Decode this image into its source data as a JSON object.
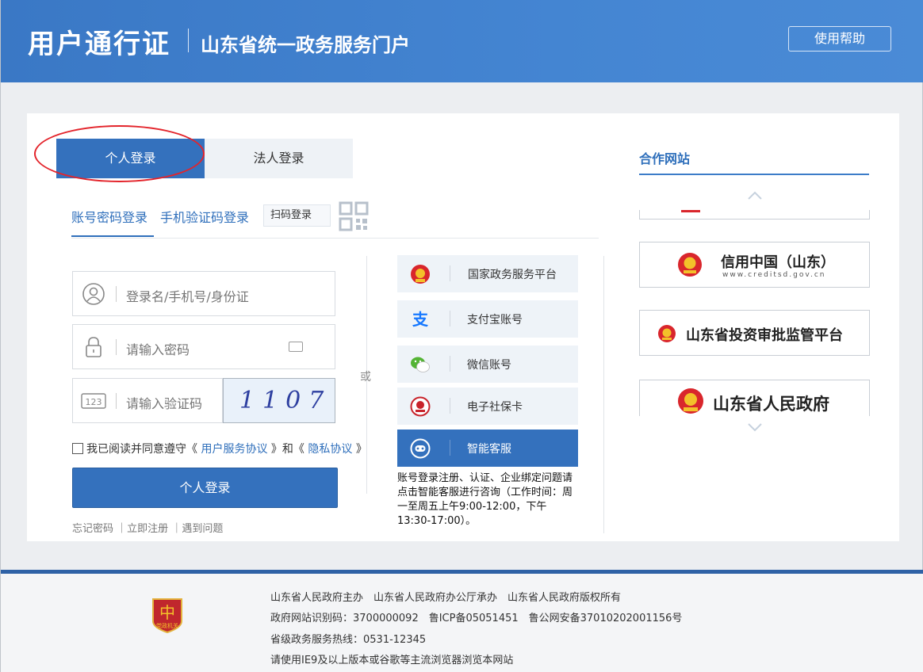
{
  "header": {
    "brand": "用户通行证",
    "portal": "山东省统一政务服务门户",
    "help_label": "使用帮助"
  },
  "login": {
    "tabs": [
      {
        "label": "个人登录",
        "active": true
      },
      {
        "label": "法人登录",
        "active": false
      }
    ],
    "modes": [
      "账号密码登录",
      "手机验证码登录",
      "扫码登录"
    ],
    "username_placeholder": "登录名/手机号/身份证",
    "password_placeholder": "请输入密码",
    "captcha_placeholder": "请输入验证码",
    "captcha_text": "1107",
    "captcha_icon_text": "123",
    "agree_prefix": "我已阅读并同意遵守《",
    "agree_link1": "用户服务协议",
    "agree_mid": "》和《",
    "agree_link2": "隐私协议",
    "agree_suffix": "》",
    "submit_label": "个人登录",
    "links": [
      "忘记密码",
      "立即注册",
      "遇到问题"
    ],
    "or_label": "或"
  },
  "third_party": {
    "items": [
      {
        "label": "国家政务服务平台",
        "icon": "national-emblem-icon"
      },
      {
        "label": "支付宝账号",
        "icon": "alipay-icon"
      },
      {
        "label": "微信账号",
        "icon": "wechat-icon"
      },
      {
        "label": "电子社保卡",
        "icon": "social-security-icon"
      },
      {
        "label": "智能客服",
        "icon": "smart-service-icon"
      }
    ],
    "note": "账号登录注册、认证、企业绑定问题请点击智能客服进行咨询（工作时间：周一至周五上午9:00-12:00，下午13:30-17:00）。"
  },
  "partners": {
    "title": "合作网站",
    "items": [
      {
        "name": "信用中国（山东）",
        "sub": "www.creditsd.gov.cn"
      },
      {
        "name": "山东省投资审批监管平台"
      },
      {
        "name": "山东省人民政府"
      }
    ]
  },
  "footer": {
    "badge_text": "党政机关",
    "line1": "山东省人民政府主办　山东省人民政府办公厅承办　山东省人民政府版权所有",
    "line2": "政府网站识别码：3700000092　鲁ICP备05051451　鲁公网安备37010202001156号",
    "line3": "省级政务服务热线：0531-12345",
    "line4": "请使用IE9及以上版本或谷歌等主流浏览器浏览本网站"
  },
  "colors": {
    "header_blue": "#3a78c5",
    "primary": "#3471bd",
    "link": "#2f6fbb",
    "annotation_red": "#e3242b"
  }
}
